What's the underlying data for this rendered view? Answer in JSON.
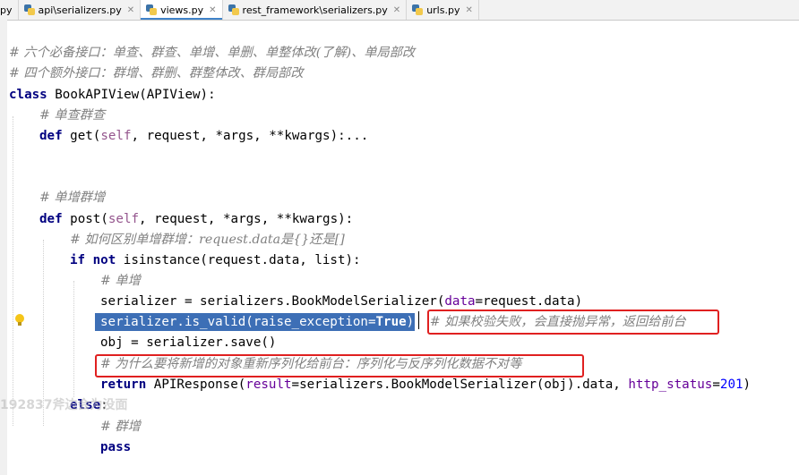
{
  "tabs": [
    {
      "label": "py",
      "active": false
    },
    {
      "label": "api\\serializers.py",
      "active": false
    },
    {
      "label": "views.py",
      "active": true
    },
    {
      "label": "rest_framework\\serializers.py",
      "active": false
    },
    {
      "label": "urls.py",
      "active": false
    }
  ],
  "code": {
    "c1": "# 六个必备接口：单查、群查、单增、单删、单整体改(了解)、单局部改",
    "c2": "# 四个额外接口：群增、群删、群整体改、群局部改",
    "class_kw": "class",
    "class_rest": " BookAPIView(APIView):",
    "c3": "# 单查群查",
    "def_kw": "def",
    "get_sig_a": " get(",
    "self": "self",
    "get_sig_b": ", request, *args, **kwargs):...",
    "c4": "# 单增群增",
    "post_sig_a": " post(",
    "post_sig_b": ", request, *args, **kwargs):",
    "c5": "# 如何区别单增群增：request.data是{}还是[]",
    "if_kw": "if",
    "not_kw": "not",
    "isinstance": " isinstance(request.data, list):",
    "c6": "# 单增",
    "ser_a": "serializer = serializers.BookModelSerializer(",
    "data_kw": "data",
    "ser_b": "=request.data)",
    "valid_a": "serializer.is_valid(raise_exception=",
    "true_kw": "True",
    "valid_b": ")",
    "c7": "# 如果校验失败，会直接抛异常，返回给前台",
    "save": "obj = serializer.save()",
    "c8": "# 为什么要将新增的对象重新序列化给前台：序列化与反序列化数据不对等",
    "return_kw": "return",
    "resp_a": " APIResponse(",
    "result_kw": "result",
    "resp_b": "=serializers.BookModelSerializer(obj).data, ",
    "status_kw": "http_status",
    "resp_c": "=",
    "num201": "201",
    "resp_d": ")",
    "else_kw": "else",
    "else_colon": ":",
    "c9": "# 群增",
    "pass_kw": "pass"
  },
  "watermark": "192837斧边会为没面",
  "colors": {
    "keyword": "#000080",
    "comment": "#808080",
    "self": "#94558d",
    "param": "#660099",
    "number": "#0000ff",
    "selection": "#3d6fb6",
    "highlight_box": "#e02020"
  }
}
